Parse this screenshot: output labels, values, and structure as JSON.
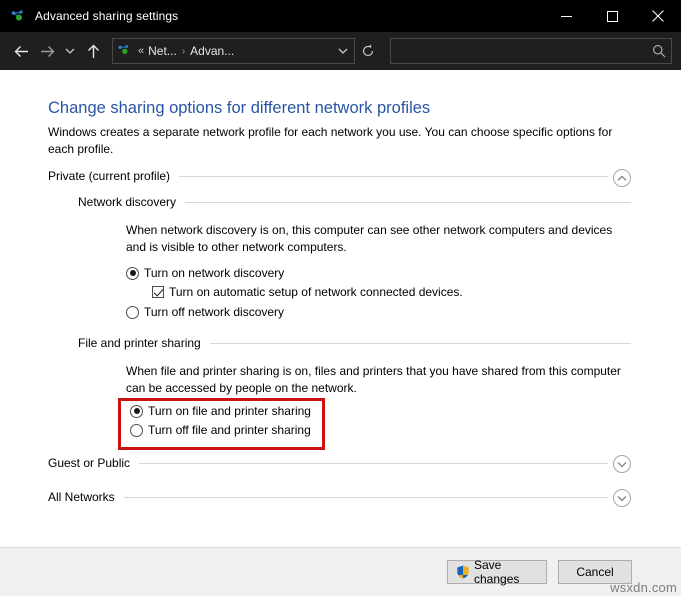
{
  "window": {
    "title": "Advanced sharing settings",
    "icon": "network-sharing-icon",
    "controls": {
      "minimize": "minimize-icon",
      "maximize": "maximize-icon",
      "close": "close-icon"
    }
  },
  "toolbar": {
    "back": "back-arrow-icon",
    "forward": "forward-arrow-icon",
    "recent": "recent-locations-chevron-icon",
    "up": "up-arrow-icon",
    "address": {
      "icon": "network-sharing-icon",
      "overflow": "«",
      "crumb1": "Net...",
      "separator": "›",
      "crumb2": "Advan...",
      "dropdown": "chevron-down-icon",
      "refresh": "refresh-icon"
    },
    "search": {
      "value": "",
      "placeholder": "",
      "icon": "search-icon"
    }
  },
  "page": {
    "title": "Change sharing options for different network profiles",
    "description": "Windows creates a separate network profile for each network you use. You can choose specific options for each profile."
  },
  "sections": {
    "private": {
      "label": "Private (current profile)",
      "expanded": true,
      "toggle_icon": "chevron-up-icon"
    },
    "guest": {
      "label": "Guest or Public",
      "expanded": false,
      "toggle_icon": "chevron-down-icon"
    },
    "all_networks": {
      "label": "All Networks",
      "expanded": false,
      "toggle_icon": "chevron-down-icon"
    }
  },
  "network_discovery": {
    "heading": "Network discovery",
    "description": "When network discovery is on, this computer can see other network computers and devices and is visible to other network computers.",
    "option_on": {
      "label": "Turn on network discovery",
      "selected": true
    },
    "sub_checkbox": {
      "label": "Turn on automatic setup of network connected devices.",
      "checked": true
    },
    "option_off": {
      "label": "Turn off network discovery",
      "selected": false
    }
  },
  "file_printer_sharing": {
    "heading": "File and printer sharing",
    "description": "When file and printer sharing is on, files and printers that you have shared from this computer can be accessed by people on the network.",
    "option_on": {
      "label": "Turn on file and printer sharing",
      "selected": true
    },
    "option_off": {
      "label": "Turn off file and printer sharing",
      "selected": false
    },
    "highlight_color": "#cc1111"
  },
  "footer": {
    "save_label": "Save changes",
    "save_icon": "uac-shield-icon",
    "cancel_label": "Cancel"
  },
  "watermark": "wsxdn.com",
  "colors": {
    "titlebar_bg": "#000000",
    "toolbar_bg": "#1f1f1f",
    "content_bg": "#ffffff",
    "heading_blue": "#2a55a5",
    "footer_bg": "#f0f0f0",
    "annotation_red": "#cc1111"
  }
}
